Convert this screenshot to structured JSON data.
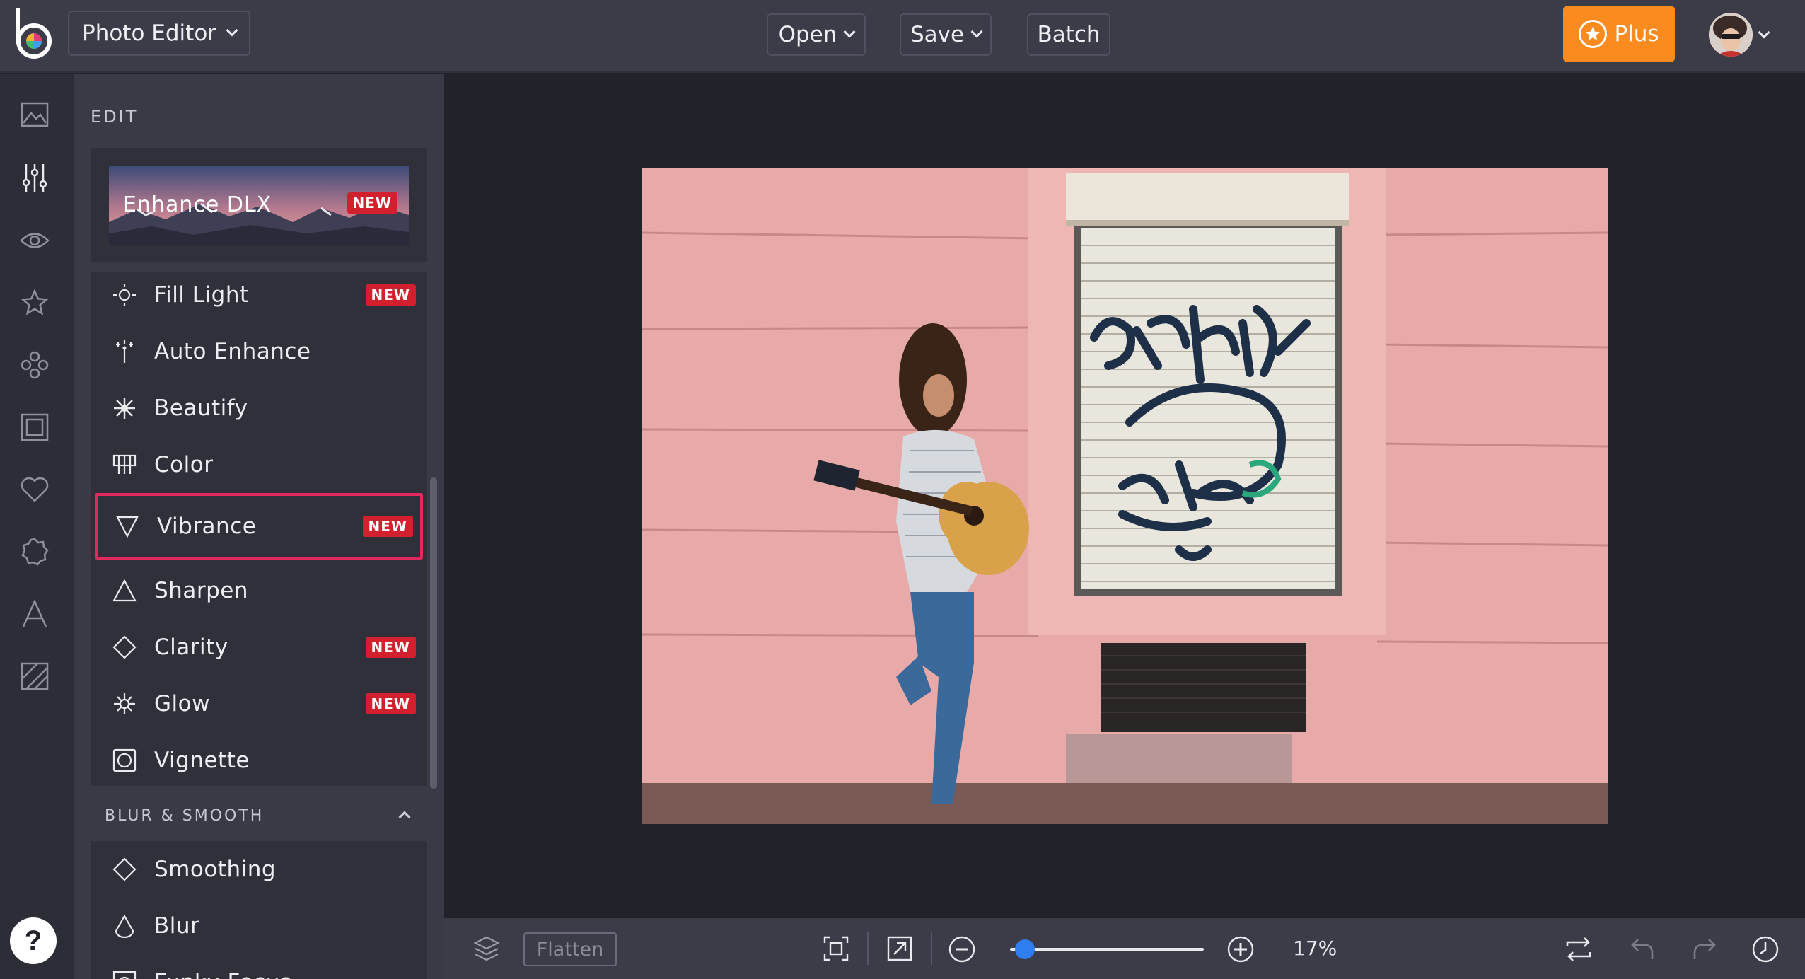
{
  "header": {
    "app_menu_label": "Photo Editor",
    "open_label": "Open",
    "save_label": "Save",
    "batch_label": "Batch",
    "plus_label": "Plus"
  },
  "rail": {
    "icons": [
      "image-icon",
      "sliders-icon",
      "eye-icon",
      "star-icon",
      "flower-icon",
      "frame-icon",
      "heart-icon",
      "badge-icon",
      "text-icon",
      "texture-icon"
    ],
    "help_label": "?"
  },
  "panel": {
    "title": "EDIT",
    "enhance": {
      "label": "Enhance DLX",
      "badge": "NEW"
    },
    "tools": [
      {
        "label": "Fill Light",
        "badge": "NEW",
        "icon": "sun-icon"
      },
      {
        "label": "Auto Enhance",
        "badge": "",
        "icon": "sparkle-icon"
      },
      {
        "label": "Beautify",
        "badge": "",
        "icon": "snowflake-icon"
      },
      {
        "label": "Color",
        "badge": "",
        "icon": "palette-icon"
      },
      {
        "label": "Vibrance",
        "badge": "NEW",
        "icon": "triangle-down-icon",
        "selected": true
      },
      {
        "label": "Sharpen",
        "badge": "",
        "icon": "triangle-up-icon"
      },
      {
        "label": "Clarity",
        "badge": "NEW",
        "icon": "diamond-icon"
      },
      {
        "label": "Glow",
        "badge": "NEW",
        "icon": "glow-icon"
      },
      {
        "label": "Vignette",
        "badge": "",
        "icon": "vignette-icon"
      }
    ],
    "section": {
      "title": "BLUR & SMOOTH"
    },
    "tools2": [
      {
        "label": "Smoothing",
        "icon": "diamond-icon"
      },
      {
        "label": "Blur",
        "icon": "drop-icon"
      },
      {
        "label": "Funky Focus",
        "icon": "focus-icon"
      }
    ]
  },
  "bottombar": {
    "flatten_label": "Flatten",
    "zoom_text": "17%",
    "zoom_fraction": 0.03
  },
  "colors": {
    "accent": "#f98b1f",
    "badge": "#d3202f",
    "selection": "#e5275f",
    "slider": "#2f7ef0"
  }
}
